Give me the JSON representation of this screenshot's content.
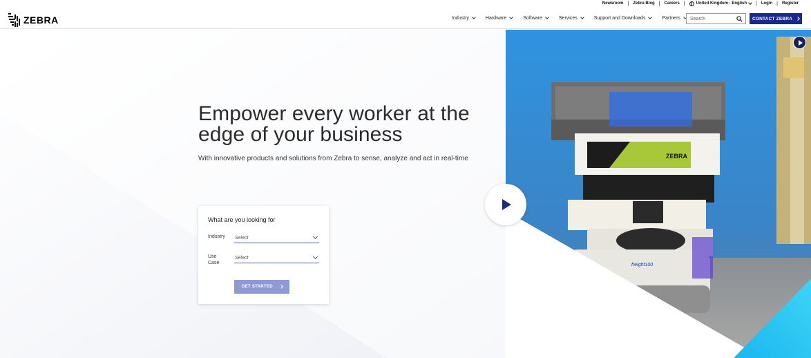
{
  "utility_nav": {
    "links": [
      "Newsroom",
      "Zebra Blog",
      "Careers"
    ],
    "locale": "United Kingdom - English",
    "login": "Login",
    "register": "Register"
  },
  "brand": {
    "name": "ZEBRA"
  },
  "main_nav": {
    "items": [
      {
        "label": "Industry"
      },
      {
        "label": "Hardware"
      },
      {
        "label": "Software"
      },
      {
        "label": "Services"
      },
      {
        "label": "Support and Downloads"
      },
      {
        "label": "Partners"
      }
    ]
  },
  "search": {
    "placeholder": "Search"
  },
  "contact_button": "CONTACT ZEBRA",
  "hero": {
    "headline_line1": "Empower every worker at the",
    "headline_line2": "edge of your business",
    "subhead": "With innovative products and solutions from Zebra to sense, analyze and act in real-time",
    "robot_brand": "ZEBRA",
    "robot_model": "freight100"
  },
  "finder": {
    "title": "What are you looking for",
    "industry_label": "Industry",
    "industry_value": "Select",
    "use_case_label_1": "Use",
    "use_case_label_2": "Case",
    "use_case_value": "Select",
    "submit": "GET STARTED"
  },
  "colors": {
    "brand_navy": "#1a2a8a",
    "button_disabled": "#8f99d3",
    "photo_blue": "#2c8fd8",
    "accent_cyan": "#27c3f0",
    "zebra_lime": "#a8c83a"
  }
}
